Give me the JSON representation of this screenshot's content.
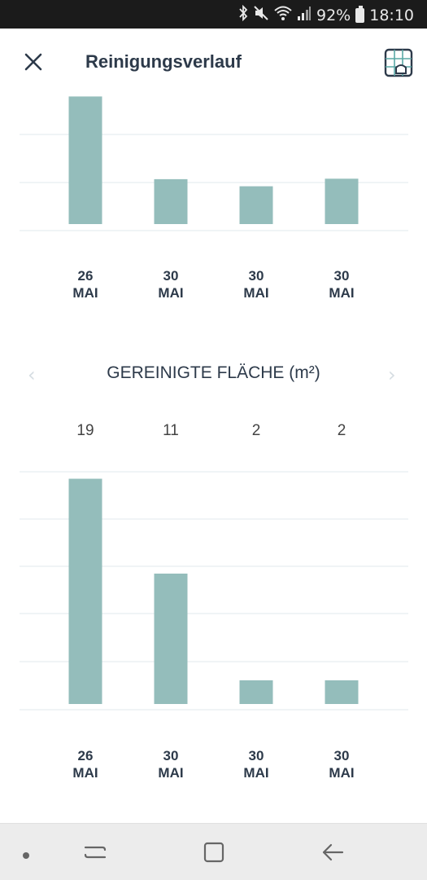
{
  "status_bar": {
    "battery": "92%",
    "time": "18:10",
    "icons": [
      "bluetooth-icon",
      "mute-icon",
      "wifi-icon",
      "signal-icon",
      "battery-icon"
    ]
  },
  "header": {
    "title": "Reinigungsverlauf",
    "close_icon": "close-icon",
    "map_icon": "floor-map-icon"
  },
  "colors": {
    "bar": "#94bdbb",
    "grid": "#e8eef0",
    "text": "#2d3a4a"
  },
  "chart_data": [
    {
      "type": "bar",
      "categories": [
        "26 MAI",
        "30 MAI",
        "30 MAI",
        "30 MAI"
      ],
      "values": [
        27,
        9.5,
        8,
        9.6
      ],
      "ylim": [
        0,
        30
      ],
      "grid": true,
      "title": ""
    },
    {
      "type": "bar",
      "title": "GEREINIGTE FLÄCHE (m²)",
      "categories": [
        "26 MAI",
        "30 MAI",
        "30 MAI",
        "30 MAI"
      ],
      "values": [
        19,
        11,
        2,
        2
      ],
      "ylim": [
        0,
        20
      ],
      "grid": true
    }
  ],
  "chart1_dates": [
    {
      "day": "26",
      "month": "MAI"
    },
    {
      "day": "30",
      "month": "MAI"
    },
    {
      "day": "30",
      "month": "MAI"
    },
    {
      "day": "30",
      "month": "MAI"
    }
  ],
  "chart2": {
    "title": "GEREINIGTE FLÄCHE (m²)",
    "values_text": [
      "19",
      "11",
      "2",
      "2"
    ],
    "prev_icon": "chevron-left-icon",
    "next_icon": "chevron-right-icon",
    "dates": [
      {
        "day": "26",
        "month": "MAI"
      },
      {
        "day": "30",
        "month": "MAI"
      },
      {
        "day": "30",
        "month": "MAI"
      },
      {
        "day": "30",
        "month": "MAI"
      }
    ]
  },
  "nav_bar": {
    "items": [
      "dot-icon",
      "recent-apps-icon",
      "home-icon",
      "back-icon"
    ]
  }
}
